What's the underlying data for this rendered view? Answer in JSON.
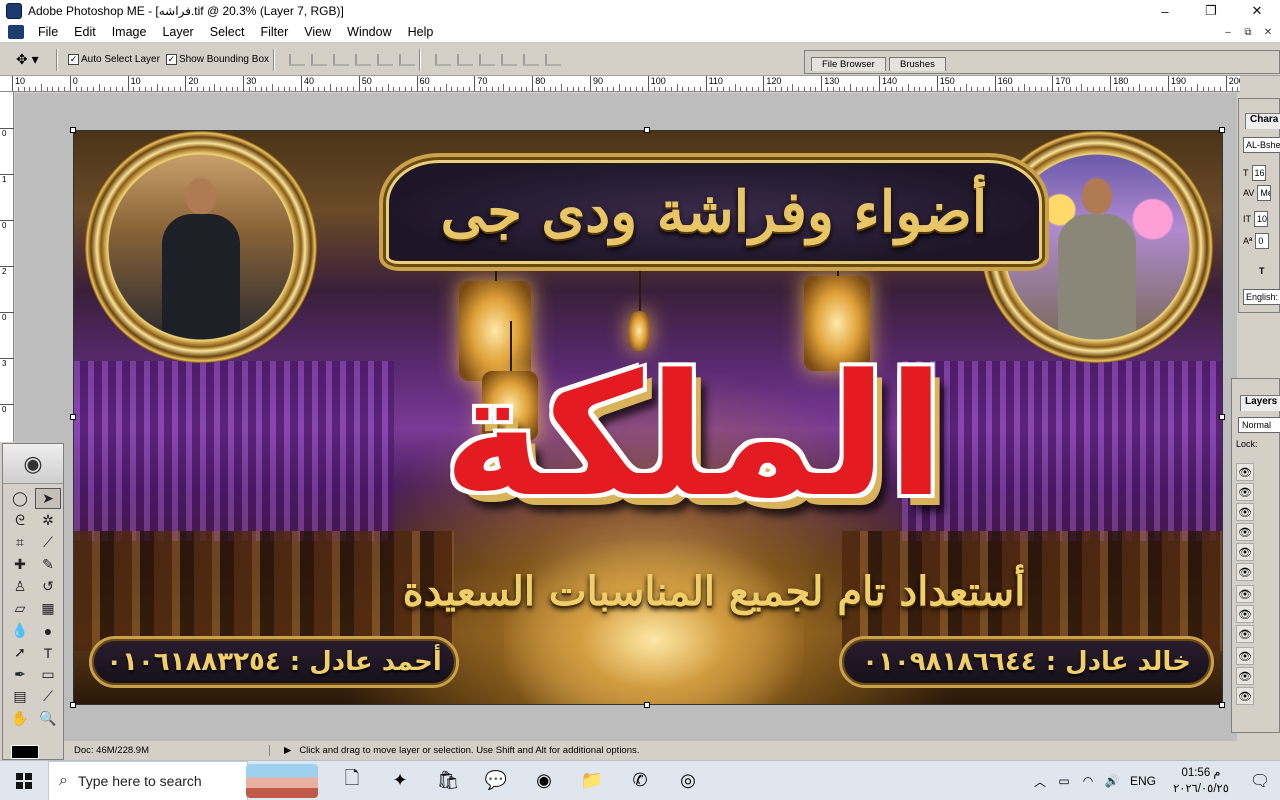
{
  "window": {
    "title": "Adobe Photoshop ME - [فراشه.tif @ 20.3% (Layer 7, RGB)]",
    "controls": [
      "–",
      "❐",
      "✕"
    ]
  },
  "menu": [
    "File",
    "Edit",
    "Image",
    "Layer",
    "Select",
    "Filter",
    "View",
    "Window",
    "Help"
  ],
  "mdi_controls": [
    "–",
    "⧉",
    "✕"
  ],
  "options": {
    "auto_select": "Auto Select Layer",
    "show_bbox": "Show Bounding Box",
    "auto_select_checked": true,
    "show_bbox_checked": true
  },
  "palette_well": {
    "tab1": "File Browser",
    "tab2": "Brushes"
  },
  "ruler": {
    "h_labels": [
      "10",
      "0",
      "10",
      "20",
      "30",
      "40",
      "50",
      "60",
      "70",
      "80",
      "90",
      "100",
      "110",
      "120",
      "130",
      "140",
      "150",
      "160",
      "170",
      "180",
      "190",
      "200"
    ],
    "v_labels": [
      "0",
      "1",
      "0",
      "2",
      "0",
      "3",
      "0"
    ]
  },
  "banner": {
    "headline": "أضواء وفراشة ودى جى",
    "big_word": "الملكة",
    "tagline": "أستعداد تام لجميع المناسبات السعيدة",
    "contact_left": "أحمد عادل : ٠١٠٦١٨٨٣٢٥٤",
    "contact_right": "خالد عادل : ٠١٠٩٨١٨٦٦٤٤"
  },
  "character_panel": {
    "tab": "Chara",
    "font": "AL-Bshe",
    "size": "16",
    "tracking": "Me",
    "scale": "10",
    "baseline": "0",
    "lang": "English:"
  },
  "layers_panel": {
    "tab": "Layers",
    "blend": "Normal",
    "lock": "Lock:"
  },
  "status": {
    "doc": "Doc: 46M/228.9M",
    "message": "Click and drag to move layer or selection.  Use Shift and Alt for additional options."
  },
  "taskbar": {
    "search_placeholder": "Type here to search",
    "lang": "ENG",
    "time": "01:56 م",
    "date": "٢٠٢٦/٠٥/٢٥"
  }
}
